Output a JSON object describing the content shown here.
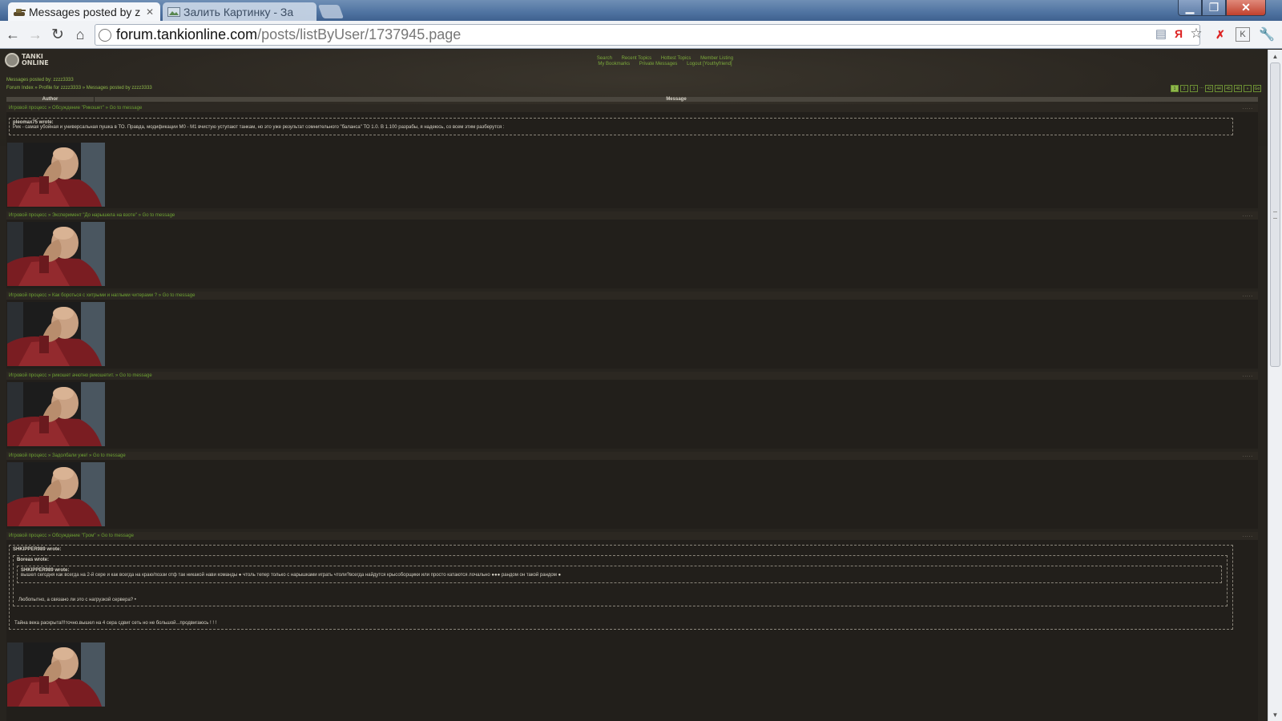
{
  "browser": {
    "tabs": [
      {
        "label": "Messages posted by z",
        "icon": "tanki-favicon",
        "active": true
      },
      {
        "label": "Залить Картинку - За",
        "icon": "image-host-favicon",
        "active": false
      }
    ],
    "url_host": "forum.tankionline.com",
    "url_path": "/posts/listByUser/1737945.page",
    "colors": {
      "titlebar": "#4f73a1",
      "toolbar": "#f1f3f6",
      "close": "#c0402d"
    }
  },
  "forum": {
    "logo_line1": "TANKI",
    "logo_line2": "ONLINE",
    "topnav": {
      "row1": [
        "Search",
        "Recent Topics",
        "Hottest Topics",
        "Member Listing"
      ],
      "row2": [
        "My Bookmarks",
        "Private Messages",
        "Logout [Youthyfriend]"
      ]
    },
    "page_title": "Messages posted by: zzzz3333",
    "breadcrumb": "Forum Index » Profile for zzzz3333 » Messages posted by zzzz3333",
    "pager": [
      "1",
      "2",
      "3",
      "...",
      "43",
      "44",
      "45",
      "46",
      "»",
      "Go"
    ],
    "columns": {
      "author": "Author",
      "message": "Message"
    },
    "accent": "#8fb84b",
    "posts": [
      {
        "head": "Игровой процесс » Обсуждение \"Рикошет\" » Go to message",
        "quote_author": "pleomax75 wrote:",
        "quote_text": "Рик - самая убойная и универсальная пушка в ТО. Правда, модификации М0 - М1 вчистую уступают танкам, но это уже результат сомнительного \"баланса\" ТО 1.0. В 1.100 разрабы, я надеюсь, со всем этим разберутся :"
      },
      {
        "head": "Игровой процесс » Эксперимент \"До нарышела на взоте\" » Go to message"
      },
      {
        "head": "Игровой процесс » Как бороться с хитрыми и наглыми читерами ? » Go to message"
      },
      {
        "head": "Игровой процесс » рикошет ачютно рикошетит. » Go to message"
      },
      {
        "head": "Игровой процесс » Задолбали уже! » Go to message"
      },
      {
        "head": "Игровой процесс » Обсуждение \"Гром\" » Go to message",
        "quote_author": "SHKIPPER989 wrote:",
        "nested_author": "Boreas wrote:",
        "nested2_author": "SHKIPPER989 wrote:",
        "nested2_text": "вышел сегодня как всегда на 2-й сере и как всегда на краю/поэзи отф так никакой нави команды ● чтоль тепер только с нарышками играть чтоли?всегда найдутся крысоборщики или просто катаются лочально ●●● рандом он такой рандом ●",
        "nested_text": "Любопытно, а связано ли это с нагрузкой сервера? •",
        "outer_text": "Тайна века раскрыта!!!точно.вышел на 4 сера сдвиг сеть но не большой...продвигаюсь ! ! !"
      }
    ]
  }
}
